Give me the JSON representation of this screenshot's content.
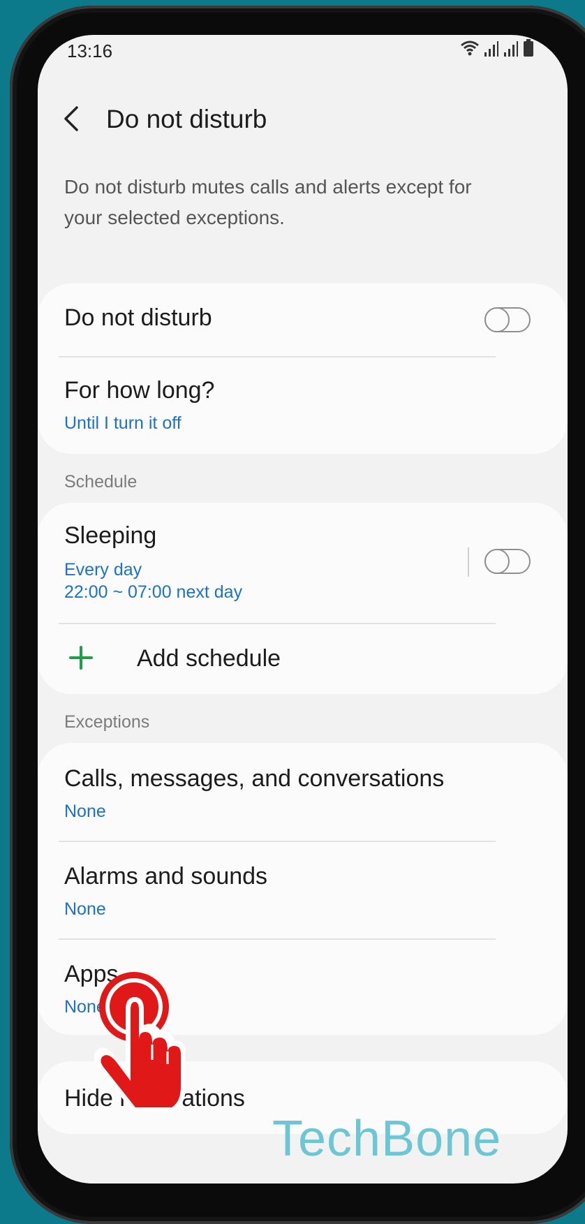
{
  "status_bar": {
    "time": "13:16",
    "icons": [
      "wifi-icon",
      "signal-icon",
      "signal-icon",
      "battery-icon"
    ]
  },
  "header": {
    "title": "Do not disturb",
    "back_icon": "chevron-left-icon"
  },
  "description": "Do not disturb mutes calls and alerts except for your selected exceptions.",
  "main_card": {
    "dnd_title": "Do not disturb",
    "dnd_enabled": false,
    "duration_title": "For how long?",
    "duration_value": "Until I turn it off"
  },
  "schedule": {
    "header": "Schedule",
    "items": [
      {
        "title": "Sleeping",
        "days": "Every day",
        "time": "22:00 ~ 07:00 next day",
        "enabled": false
      }
    ],
    "add_label": "Add schedule"
  },
  "exceptions": {
    "header": "Exceptions",
    "items": [
      {
        "title": "Calls, messages, and conversations",
        "value": "None"
      },
      {
        "title": "Alarms and sounds",
        "value": "None"
      },
      {
        "title": "Apps",
        "value": "None"
      }
    ]
  },
  "hide_notifications": {
    "title": "Hide notifications"
  },
  "watermark": "TechBone",
  "colors": {
    "background": "#0d7a8c",
    "screen": "#f2f2f2",
    "card": "#fbfbfb",
    "accent_blue": "#1b72c9",
    "plus_green": "#1e9e4a",
    "tap_red": "#e01818",
    "watermark": "#6cc6d4"
  }
}
